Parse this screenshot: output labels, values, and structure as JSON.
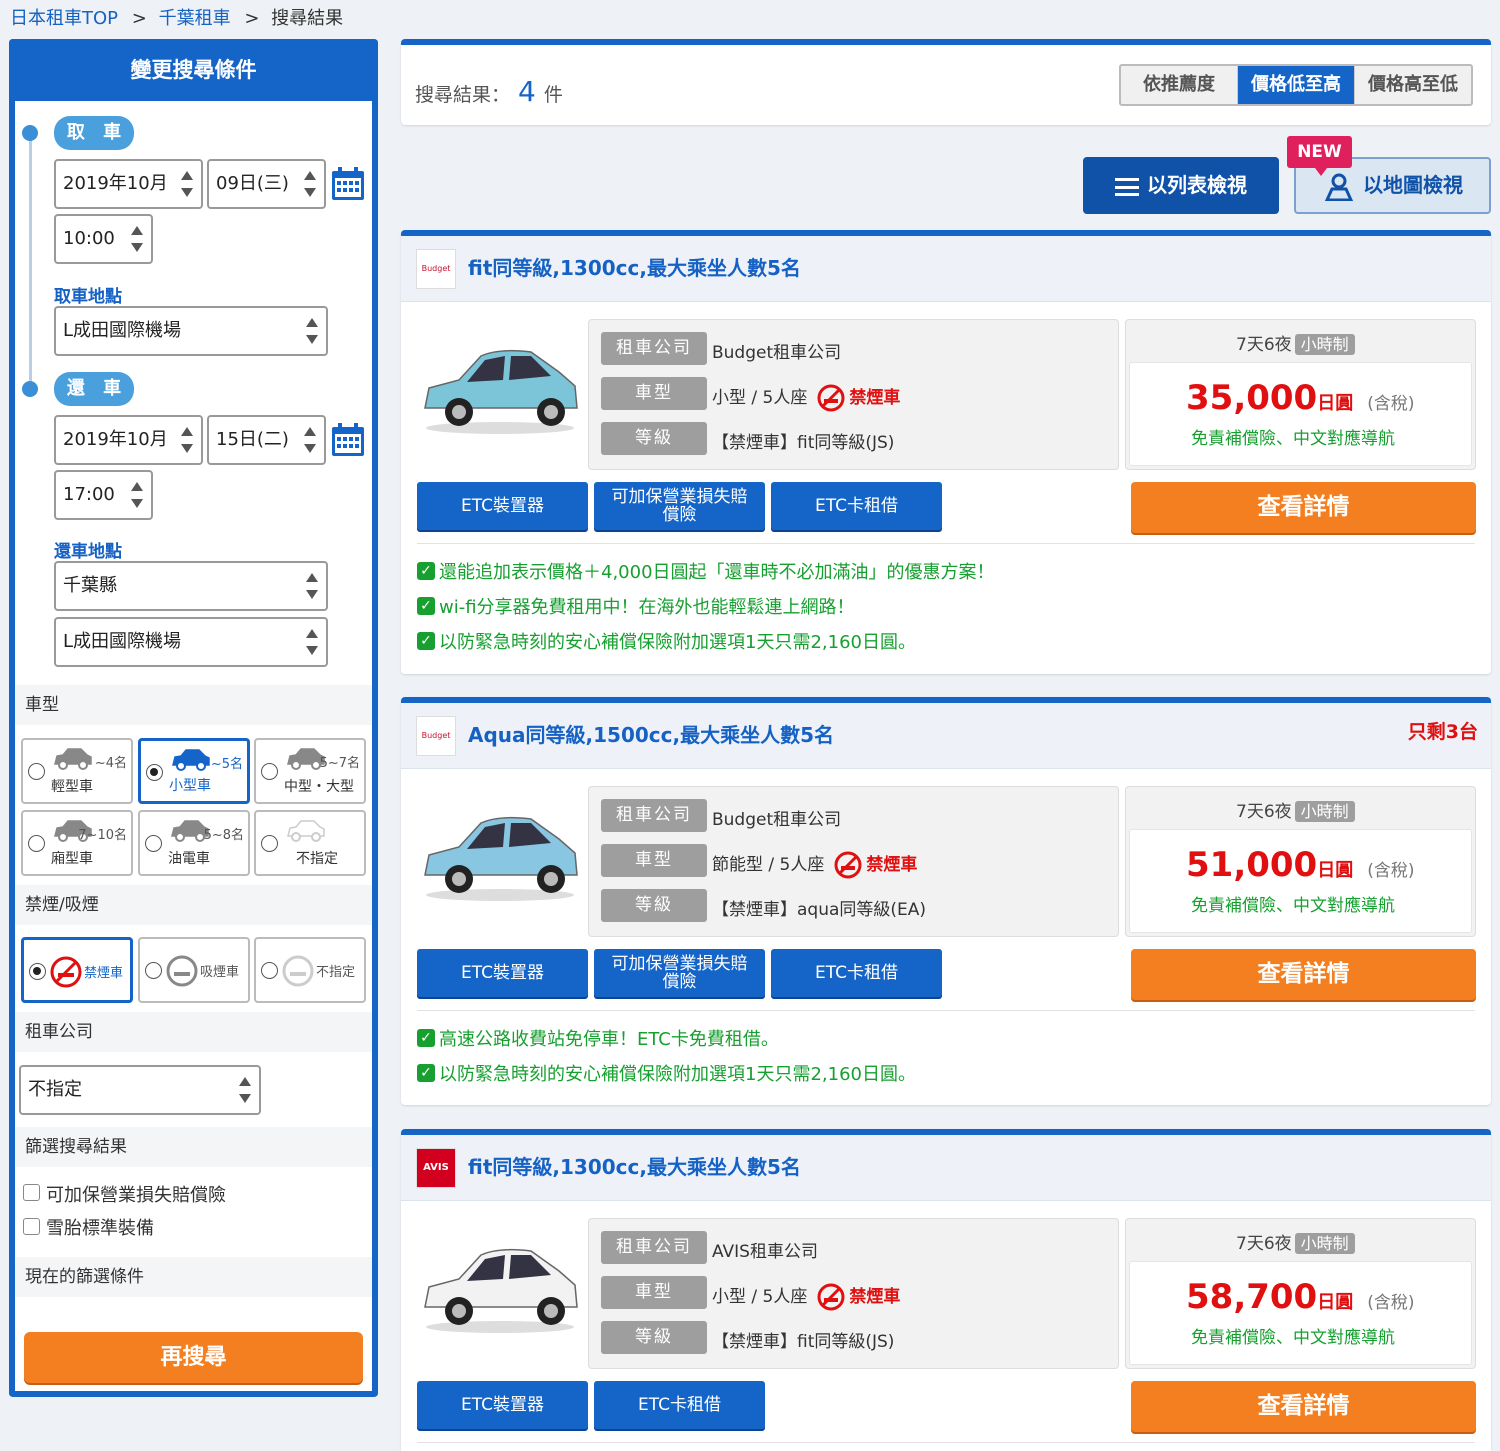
{
  "breadcrumb": {
    "items": [
      "日本租車TOP",
      "千葉租車"
    ],
    "separator": ">",
    "current": "搜尋結果"
  },
  "sidebar": {
    "title": "變更搜尋條件",
    "pickup": {
      "label": "取 車",
      "month": "2019年10月",
      "day": "09日(三)",
      "time": "10:00",
      "location_label": "取車地點",
      "location": "L成田國際機場"
    },
    "return": {
      "label": "還 車",
      "month": "2019年10月",
      "day": "15日(二)",
      "time": "17:00",
      "location_label": "還車地點",
      "prefecture": "千葉縣",
      "location": "L成田國際機場"
    },
    "car_type": {
      "label": "車型",
      "options": [
        {
          "cap": "~4名",
          "name": "輕型車",
          "selected": false
        },
        {
          "cap": "~5名",
          "name": "小型車",
          "selected": true
        },
        {
          "cap": "5~7名",
          "name": "中型・大型",
          "selected": false
        },
        {
          "cap": "7~10名",
          "name": "廂型車",
          "selected": false
        },
        {
          "cap": "5~8名",
          "name": "油電車",
          "selected": false
        },
        {
          "cap": "",
          "name": "不指定",
          "selected": false
        }
      ]
    },
    "smoking": {
      "label": "禁煙/吸煙",
      "options": [
        {
          "name": "禁煙車",
          "selected": true
        },
        {
          "name": "吸煙車",
          "selected": false
        },
        {
          "name": "不指定",
          "selected": false
        }
      ]
    },
    "company": {
      "label": "租車公司",
      "value": "不指定"
    },
    "filter": {
      "label": "篩選搜尋結果",
      "options": [
        "可加保營業損失賠償險",
        "雪胎標準裝備"
      ]
    },
    "current_filter_label": "現在的篩選條件",
    "search_button": "再搜尋"
  },
  "results": {
    "label": "搜尋結果：",
    "count": "4",
    "unit": "件"
  },
  "sort": {
    "options": [
      "依推薦度",
      "價格低至高",
      "價格高至低"
    ],
    "active": 1
  },
  "views": {
    "list": "以列表檢視",
    "map": "以地圖檢視",
    "new_badge": "NEW"
  },
  "labels": {
    "company": "租車公司",
    "car_type": "車型",
    "grade": "等級",
    "nights": "7天6夜",
    "hourly": "小時制",
    "yen": "日圓",
    "tax": "(含稅)",
    "free": "免責補償險、中文對應導航",
    "details": "查看詳情",
    "nosmoke": "禁煙車"
  },
  "cards": [
    {
      "logo": "Budget",
      "title": "fit同等級,1300cc,最大乘坐人數5名",
      "remaining": "",
      "company": "Budget租車公司",
      "car_type": "小型 / 5人座",
      "grade": "【禁煙車】fit同等級(JS)",
      "price": "35,000",
      "car_color": "#7cc4d8",
      "buttons": [
        "ETC裝置器",
        "可加保營業損失賠償險",
        "ETC卡租借"
      ],
      "features": [
        "還能追加表示價格＋4,000日圓起「還車時不必加滿油」的優惠方案！",
        "wi-fi分享器免費租用中！在海外也能輕鬆連上網路！",
        "以防緊急時刻的安心補償保險附加選項1天只需2,160日圓。"
      ]
    },
    {
      "logo": "Budget",
      "title": "Aqua同等級,1500cc,最大乘坐人數5名",
      "remaining": "只剩3台",
      "company": "Budget租車公司",
      "car_type": "節能型 / 5人座",
      "grade": "【禁煙車】aqua同等級(EA)",
      "price": "51,000",
      "car_color": "#88c6e2",
      "buttons": [
        "ETC裝置器",
        "可加保營業損失賠償險",
        "ETC卡租借"
      ],
      "features": [
        "高速公路收費站免停車！ETC卡免費租借。",
        "以防緊急時刻的安心補償保險附加選項1天只需2,160日圓。"
      ]
    },
    {
      "logo": "AVIS",
      "title": "fit同等級,1300cc,最大乘坐人數5名",
      "remaining": "",
      "company": "AVIS租車公司",
      "car_type": "小型 / 5人座",
      "grade": "【禁煙車】fit同等級(JS)",
      "price": "58,700",
      "car_color": "#f2f2f2",
      "buttons": [
        "ETC裝置器",
        "ETC卡租借"
      ],
      "features": []
    }
  ],
  "colors": {
    "primary": "#1565c8",
    "orange": "#f47f20",
    "red": "#e01010",
    "green": "#17a030"
  }
}
